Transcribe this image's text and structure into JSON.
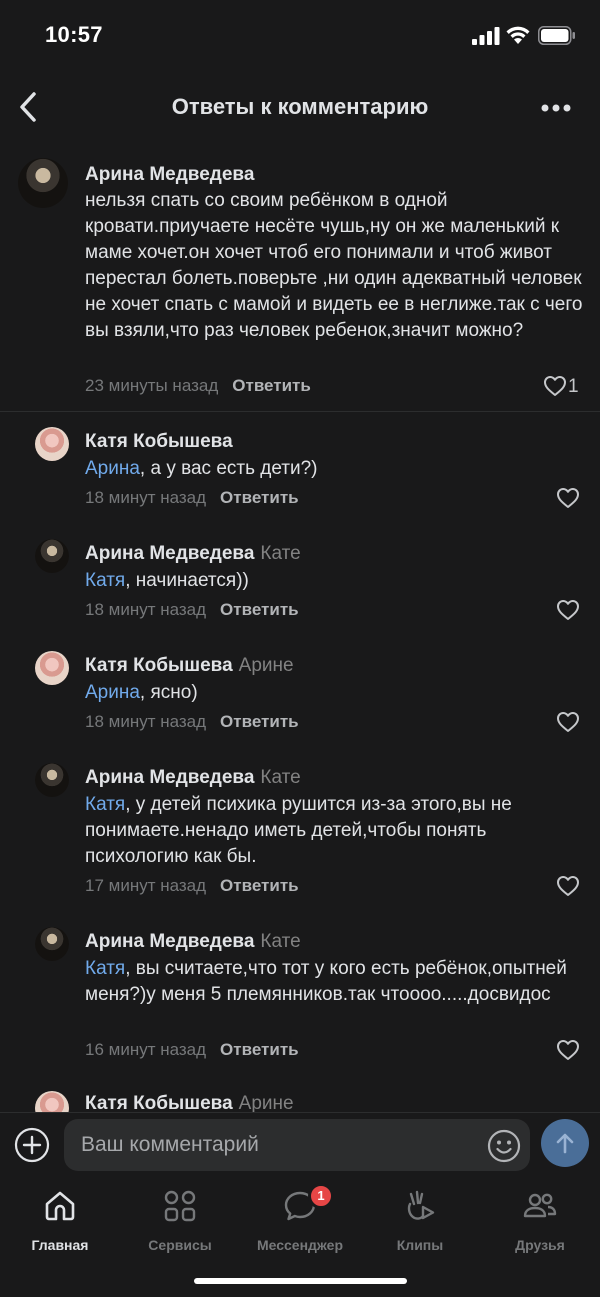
{
  "status_bar": {
    "time": "10:57"
  },
  "header": {
    "title": "Ответы к комментарию"
  },
  "root_comment": {
    "author": "Арина Медведева",
    "text": "нельзя спать со своим ребёнком в одной кровати.приучаете несёте чушь,ну он же маленький к маме хочет.он хочет чтоб его понимали и чтоб живот перестал болеть.поверьте ,ни один адекватный человек не хочет спать с мамой и видеть ее в неглиже.так с чего вы взяли,что раз человек ребенок,значит можно?",
    "time": "23 минуты назад",
    "reply": "Ответить",
    "likes": "1"
  },
  "replies": [
    {
      "author": "Катя Кобышева",
      "to": "",
      "mention": "Арина",
      "text": ", а у вас есть дети?)",
      "time": "18 минут назад",
      "reply": "Ответить"
    },
    {
      "author": "Арина Медведева",
      "to": "Кате",
      "mention": "Катя",
      "text": ", начинается))",
      "time": "18 минут назад",
      "reply": "Ответить"
    },
    {
      "author": "Катя Кобышева",
      "to": "Арине",
      "mention": "Арина",
      "text": ", ясно)",
      "time": "18 минут назад",
      "reply": "Ответить"
    },
    {
      "author": "Арина Медведева",
      "to": "Кате",
      "mention": "Катя",
      "text": ", у детей психика рушится из-за этого,вы не понимаете.ненадо иметь детей,чтобы понять психологию как бы.",
      "time": "17 минут назад",
      "reply": "Ответить"
    },
    {
      "author": "Арина Медведева",
      "to": "Кате",
      "mention": "Катя",
      "text": ", вы считаете,что тот у кого есть ребёнок,опытней меня?)у меня 5 племянников.так чтоооо.....досвидос",
      "time": "16 минут назад",
      "reply": "Ответить"
    },
    {
      "author": "Катя Кобышева",
      "to": "Арине"
    }
  ],
  "input": {
    "placeholder": "Ваш комментарий"
  },
  "tabs": [
    {
      "label": "Главная",
      "icon": "home-icon",
      "active": true
    },
    {
      "label": "Сервисы",
      "icon": "services-icon"
    },
    {
      "label": "Мессенджер",
      "icon": "messenger-icon",
      "badge": "1"
    },
    {
      "label": "Клипы",
      "icon": "clips-icon"
    },
    {
      "label": "Друзья",
      "icon": "friends-icon"
    }
  ],
  "colors": {
    "background": "#19191a",
    "mention": "#71aaeb",
    "badge": "#e64646",
    "send_button": "#4a6e98"
  }
}
